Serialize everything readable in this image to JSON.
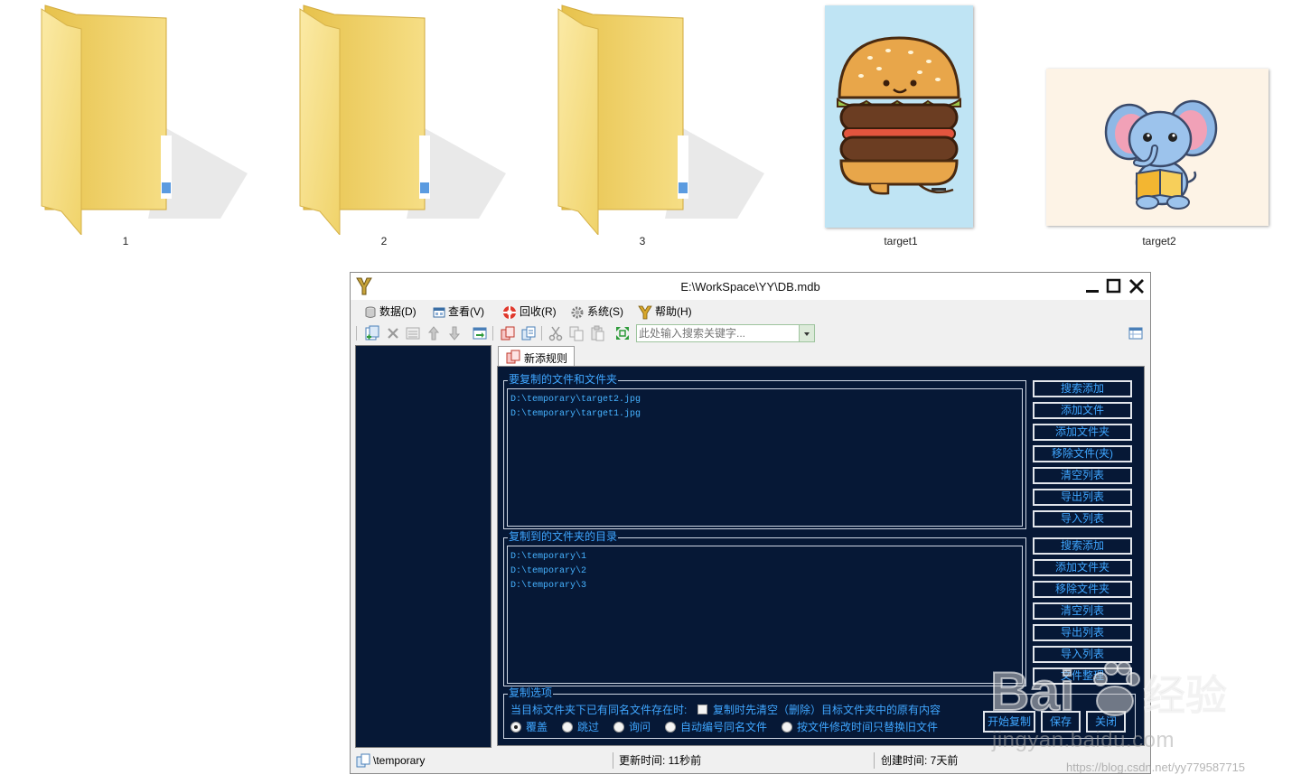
{
  "files": [
    {
      "label": "1",
      "kind": "folder"
    },
    {
      "label": "2",
      "kind": "folder"
    },
    {
      "label": "3",
      "kind": "folder"
    },
    {
      "label": "target1",
      "kind": "image-hamburger"
    },
    {
      "label": "target2",
      "kind": "image-elephant"
    }
  ],
  "window": {
    "title": "E:\\WorkSpace\\YY\\DB.mdb",
    "menu": [
      {
        "label": "数据(D)",
        "icon": "database-icon"
      },
      {
        "label": "查看(V)",
        "icon": "view-icon"
      },
      {
        "label": "回收(R)",
        "icon": "lifebuoy-icon"
      },
      {
        "label": "系统(S)",
        "icon": "gear-icon"
      },
      {
        "label": "帮助(H)",
        "icon": "help-y-icon"
      }
    ],
    "search": {
      "placeholder": "此处输入搜索关键字..."
    },
    "tab": "新添规则",
    "sources": {
      "title": "要复制的文件和文件夹",
      "items": [
        "D:\\temporary\\target2.jpg",
        "D:\\temporary\\target1.jpg"
      ],
      "buttons": [
        "搜索添加",
        "添加文件",
        "添加文件夹",
        "移除文件(夹)",
        "清空列表",
        "导出列表",
        "导入列表"
      ]
    },
    "targets": {
      "title": "复制到的文件夹的目录",
      "items": [
        "D:\\temporary\\1",
        "D:\\temporary\\2",
        "D:\\temporary\\3"
      ],
      "buttons": [
        "搜索添加",
        "添加文件夹",
        "移除文件夹",
        "清空列表",
        "导出列表",
        "导入列表",
        "文件整理"
      ]
    },
    "options": {
      "title": "复制选项",
      "conflict_label": "当目标文件夹下已有同名文件存在时:",
      "clear_first_label": "复制时先清空（删除）目标文件夹中的原有内容",
      "clear_first_checked": false,
      "radios": [
        {
          "label": "覆盖",
          "selected": true
        },
        {
          "label": "跳过",
          "selected": false
        },
        {
          "label": "询问",
          "selected": false
        },
        {
          "label": "自动编号同名文件",
          "selected": false
        },
        {
          "label": "按文件修改时间只替换旧文件",
          "selected": false
        }
      ],
      "actions": [
        "开始复制",
        "保存",
        "关闭"
      ]
    },
    "status": {
      "path": "\\temporary",
      "updated": "更新时间: 11秒前",
      "created": "创建时间: 7天前"
    }
  },
  "watermark": {
    "brand": "Baidu经验",
    "sub": "jingyan.baidu.com",
    "url": "https://blog.csdn.net/yy779587715"
  }
}
